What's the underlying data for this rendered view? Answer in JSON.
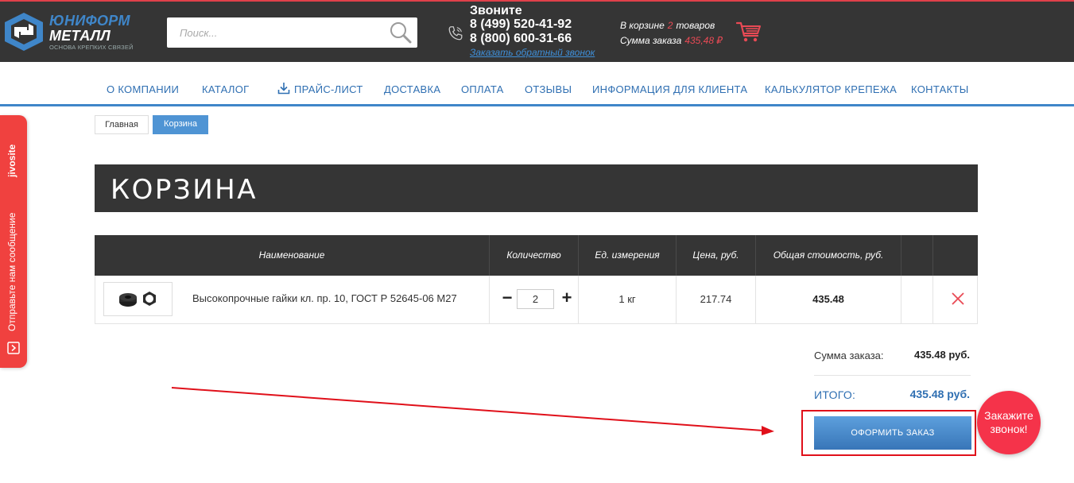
{
  "header": {
    "logo": {
      "line1": "ЮНИФОРМ",
      "line2": "МЕТАЛЛ",
      "tagline": "ОСНОВА КРЕПКИХ СВЯЗЕЙ"
    },
    "search": {
      "placeholder": "Поиск..."
    },
    "contacts": {
      "call_label": "Звоните",
      "phone1": "8 (499) 520-41-92",
      "phone2": "8 (800) 600-31-66",
      "callback_link": "Заказать обратный звонок"
    },
    "cart": {
      "in_cart_label": "В корзине",
      "count": "2",
      "items_word": "товаров",
      "sum_label": "Сумма заказа",
      "sum_value": "435,48 ₽"
    },
    "colors": {
      "bg": "#353535",
      "accent": "#3f86c9",
      "red": "#e94a55"
    }
  },
  "nav": {
    "items": [
      {
        "label": "О КОМПАНИИ"
      },
      {
        "label": "КАТАЛОГ"
      },
      {
        "label": "ПРАЙС-ЛИСТ",
        "icon": "download-icon"
      },
      {
        "label": "ДОСТАВКА"
      },
      {
        "label": "ОПЛАТА"
      },
      {
        "label": "ОТЗЫВЫ"
      },
      {
        "label": "ИНФОРМАЦИЯ ДЛЯ КЛИЕНТА"
      },
      {
        "label": "КАЛЬКУЛЯТОР КРЕПЕЖА"
      },
      {
        "label": "КОНТАКТЫ"
      }
    ]
  },
  "breadcrumb": {
    "home": "Главная",
    "current": "Корзина"
  },
  "page": {
    "title": "КОРЗИНА"
  },
  "cart_table": {
    "headers": [
      "Наименование",
      "Количество",
      "Ед. измерения",
      "Цена, руб.",
      "Общая стоимость, руб."
    ],
    "rows": [
      {
        "name": "Высокопрочные гайки кл. пр. 10, ГОСТ Р 52645-06 М27",
        "quantity": "2",
        "unit": "1 кг",
        "price": "217.74",
        "total": "435.48"
      }
    ]
  },
  "summary": {
    "sum_label": "Сумма заказа:",
    "sum_value": "435.48 руб.",
    "total_label": "ИТОГО:",
    "total_value": "435.48 руб.",
    "order_button": "ОФОРМИТЬ ЗАКАЗ"
  },
  "callback_bubble": {
    "line1": "Закажите",
    "line2": "звонок!"
  },
  "jivosite": {
    "brand": "jivosite",
    "message": "Отправьте нам сообщение"
  }
}
